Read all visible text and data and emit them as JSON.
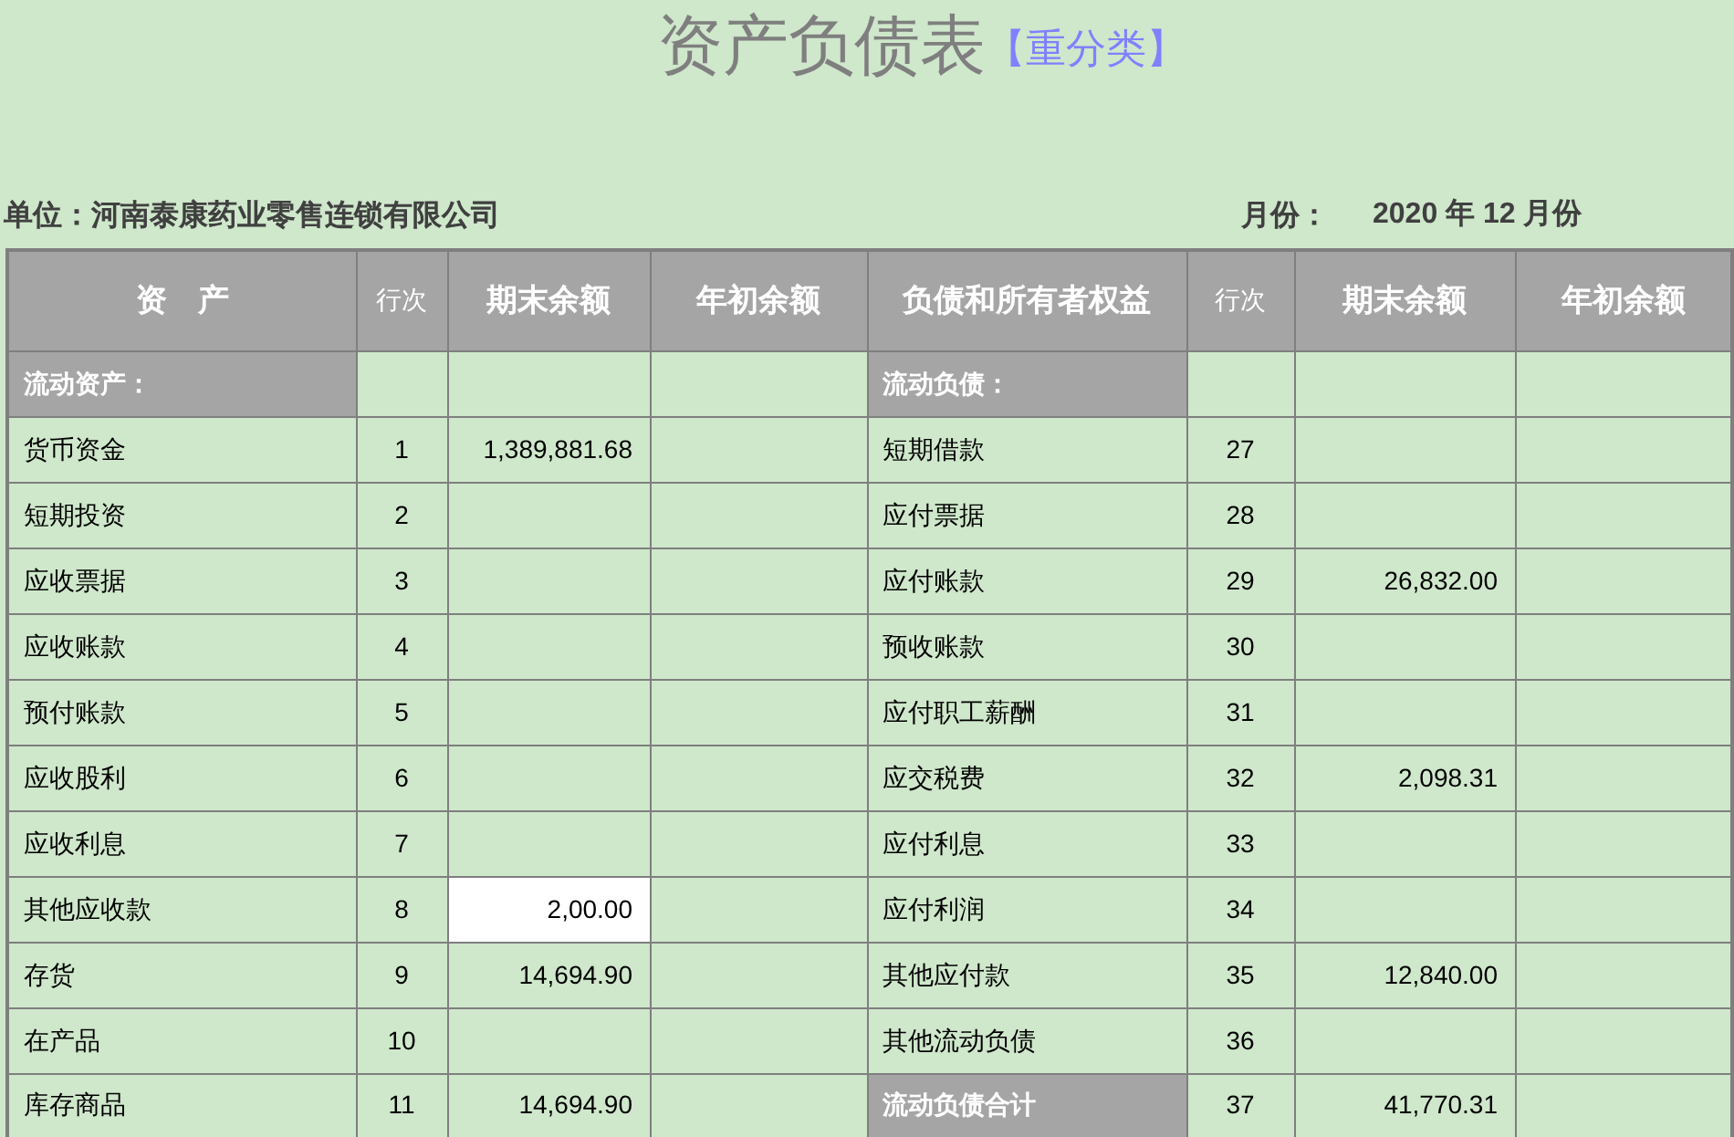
{
  "title": "资产负债表",
  "title_tag": "【重分类】",
  "unit": "单位：河南泰康药业零售连锁有限公司",
  "month_label": "月份：",
  "month_value": "2020 年 12 月份",
  "columns": [
    "资　产",
    "行次",
    "期末余额",
    "年初余额",
    "负债和所有者权益",
    "行次",
    "期末余额",
    "年初余额"
  ],
  "rows": [
    {
      "left": {
        "kind": "section",
        "name": "流动资产：",
        "selected": false
      },
      "right": {
        "kind": "section",
        "name": "流动负债："
      }
    },
    {
      "left": {
        "kind": "item",
        "name": "货币资金",
        "line": "1",
        "end": "1,389,881.68",
        "selected": false
      },
      "right": {
        "kind": "item",
        "name": "短期借款",
        "line": "27"
      }
    },
    {
      "left": {
        "kind": "item",
        "name": "短期投资",
        "line": "2",
        "selected": false
      },
      "right": {
        "kind": "item",
        "name": "应付票据",
        "line": "28"
      }
    },
    {
      "left": {
        "kind": "item",
        "name": "应收票据",
        "line": "3",
        "selected": false
      },
      "right": {
        "kind": "item",
        "name": "应付账款",
        "line": "29",
        "end": "26,832.00"
      }
    },
    {
      "left": {
        "kind": "item",
        "name": "应收账款",
        "line": "4",
        "selected": false
      },
      "right": {
        "kind": "item",
        "name": "预收账款",
        "line": "30"
      }
    },
    {
      "left": {
        "kind": "item",
        "name": "预付账款",
        "line": "5",
        "selected": false
      },
      "right": {
        "kind": "item",
        "name": "应付职工薪酬",
        "line": "31"
      }
    },
    {
      "left": {
        "kind": "item",
        "name": "应收股利",
        "line": "6",
        "selected": false
      },
      "right": {
        "kind": "item",
        "name": "应交税费",
        "line": "32",
        "end": "2,098.31"
      }
    },
    {
      "left": {
        "kind": "item",
        "name": "应收利息",
        "line": "7",
        "selected": false
      },
      "right": {
        "kind": "item",
        "name": "应付利息",
        "line": "33"
      }
    },
    {
      "left": {
        "kind": "item",
        "name": "其他应收款",
        "line": "8",
        "end": "2,00.00",
        "selected": true
      },
      "right": {
        "kind": "item",
        "name": "应付利润",
        "line": "34"
      }
    },
    {
      "left": {
        "kind": "item",
        "name": "存货",
        "line": "9",
        "end": "14,694.90",
        "selected": false
      },
      "right": {
        "kind": "item",
        "name": "其他应付款",
        "line": "35",
        "end": "12,840.00"
      }
    },
    {
      "left": {
        "kind": "item",
        "name": "在产品",
        "line": "10",
        "selected": false
      },
      "right": {
        "kind": "item",
        "name": "其他流动负债",
        "line": "36"
      }
    },
    {
      "left": {
        "kind": "item",
        "name": "库存商品",
        "line": "11",
        "end": "14,694.90",
        "selected": false
      },
      "right": {
        "kind": "total",
        "name": "流动负债合计",
        "line": "37",
        "end": "41,770.31"
      }
    }
  ]
}
